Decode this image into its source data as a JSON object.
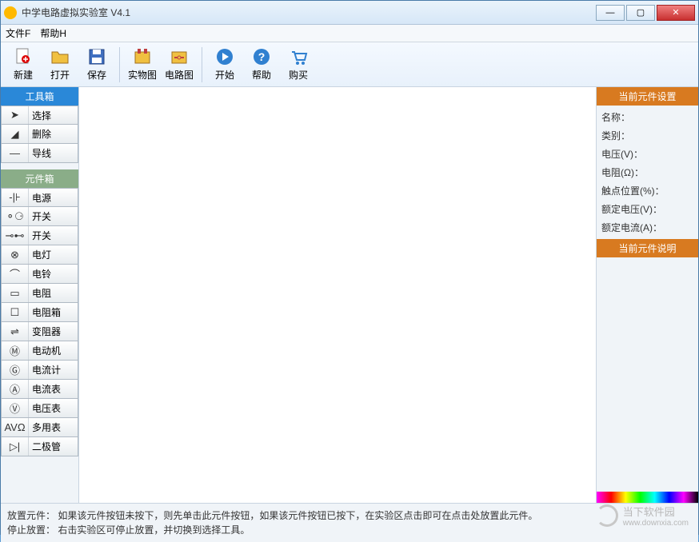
{
  "window": {
    "title": "中学电路虚拟实验室 V4.1"
  },
  "menu": {
    "file": "文件F",
    "help": "帮助H"
  },
  "toolbar": {
    "new": "新建",
    "open": "打开",
    "save": "保存",
    "real": "实物图",
    "circuit": "电路图",
    "start": "开始",
    "help": "帮助",
    "buy": "购买"
  },
  "toolbox": {
    "title": "工具箱",
    "select": "选择",
    "delete": "删除",
    "wire": "导线"
  },
  "components": {
    "title": "元件箱",
    "items": [
      {
        "icon": "-|⊦",
        "label": "电源"
      },
      {
        "icon": "⚬⚆",
        "label": "开关"
      },
      {
        "icon": "⊸⊷",
        "label": "开关"
      },
      {
        "icon": "⊗",
        "label": "电灯"
      },
      {
        "icon": "⌒",
        "label": "电铃"
      },
      {
        "icon": "▭",
        "label": "电阻"
      },
      {
        "icon": "☐",
        "label": "电阻箱"
      },
      {
        "icon": "⇌",
        "label": "变阻器"
      },
      {
        "icon": "Ⓜ",
        "label": "电动机"
      },
      {
        "icon": "Ⓖ",
        "label": "电流计"
      },
      {
        "icon": "Ⓐ",
        "label": "电流表"
      },
      {
        "icon": "Ⓥ",
        "label": "电压表"
      },
      {
        "icon": "AVΩ",
        "label": "多用表"
      },
      {
        "icon": "▷|",
        "label": "二极管"
      }
    ]
  },
  "props": {
    "title": "当前元件设置",
    "name": "名称：",
    "type": "类别：",
    "volt": "电压(V)：",
    "res": "电阻(Ω)：",
    "contact": "触点位置(%)：",
    "ratedV": "额定电压(V)：",
    "ratedA": "额定电流(A)："
  },
  "desc": {
    "title": "当前元件说明"
  },
  "status": {
    "line1": "放置元件：   如果该元件按钮未按下，则先单击此元件按钮，如果该元件按钮已按下，在实验区点击即可在点击处放置此元件。",
    "line2": "停止放置：   右击实验区可停止放置，并切换到选择工具。"
  },
  "watermark": {
    "text": "当下软件园",
    "url": "www.downxia.com"
  }
}
